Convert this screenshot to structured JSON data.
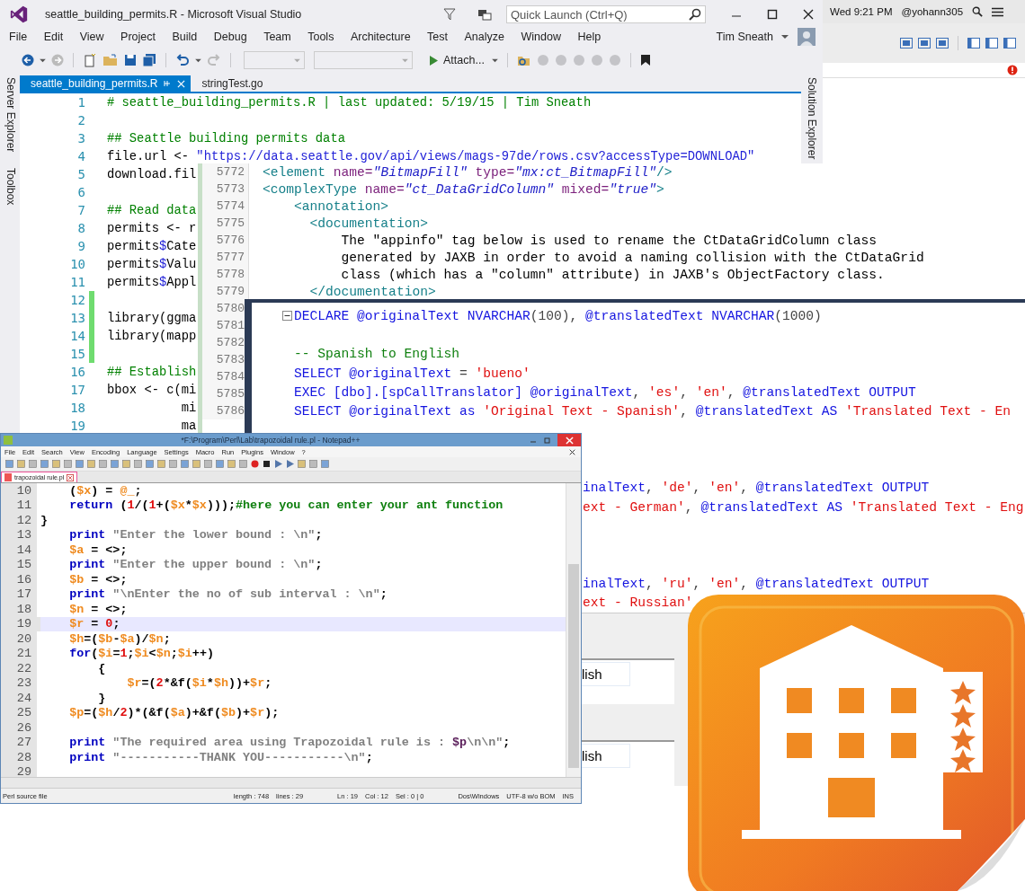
{
  "vs": {
    "title": "seattle_building_permits.R - Microsoft Visual Studio",
    "quick_launch": {
      "placeholder": "Quick Launch (Ctrl+Q)"
    },
    "menu": [
      "File",
      "Edit",
      "View",
      "Project",
      "Build",
      "Debug",
      "Team",
      "Tools",
      "Architecture",
      "Test",
      "Analyze",
      "Window",
      "Help"
    ],
    "user": "Tim Sneath",
    "attach_button": "Attach...",
    "side_tabs": [
      "Server Explorer",
      "Toolbox"
    ],
    "right_tab": "Solution Explorer",
    "tabs": [
      {
        "label": "seattle_building_permits.R",
        "selected": true
      },
      {
        "label": "stringTest.go",
        "selected": false
      }
    ],
    "lines": [
      {
        "n": "1",
        "changed": false,
        "tokens": [
          {
            "kind": "cmt",
            "text": "# seattle_building_permits.R | last updated: 5/19/15 | Tim Sneath"
          }
        ]
      },
      {
        "n": "2",
        "changed": false
      },
      {
        "n": "3",
        "changed": false,
        "tokens": [
          {
            "kind": "cmt",
            "text": "## Seattle building permits data"
          }
        ]
      },
      {
        "n": "4",
        "changed": false,
        "tokens": [
          {
            "kind": "plain",
            "text": "file.url <- "
          },
          {
            "kind": "str",
            "text": "\"https://data.seattle.gov/api/views/mags-97de/rows.csv?accessType=DOWNLOAD\""
          }
        ]
      },
      {
        "n": "5",
        "changed": false,
        "tokens": [
          {
            "kind": "plain",
            "text": "download.fil"
          }
        ]
      },
      {
        "n": "6",
        "changed": false
      },
      {
        "n": "7",
        "changed": false,
        "tokens": [
          {
            "kind": "cmt",
            "text": "## Read data"
          }
        ]
      },
      {
        "n": "8",
        "changed": false,
        "tokens": [
          {
            "kind": "plain",
            "text": "permits <- r"
          }
        ]
      },
      {
        "n": "9",
        "changed": false,
        "tokens": [
          {
            "kind": "plain",
            "text": "permits"
          },
          {
            "kind": "op",
            "text": "$"
          },
          {
            "kind": "plain",
            "text": "Cate"
          }
        ]
      },
      {
        "n": "10",
        "changed": false,
        "tokens": [
          {
            "kind": "plain",
            "text": "permits"
          },
          {
            "kind": "op",
            "text": "$"
          },
          {
            "kind": "plain",
            "text": "Valu"
          }
        ]
      },
      {
        "n": "11",
        "changed": false,
        "tokens": [
          {
            "kind": "plain",
            "text": "permits"
          },
          {
            "kind": "op",
            "text": "$"
          },
          {
            "kind": "plain",
            "text": "Appl"
          }
        ]
      },
      {
        "n": "12",
        "changed": true
      },
      {
        "n": "13",
        "changed": true,
        "tokens": [
          {
            "kind": "plain",
            "text": "library(ggma"
          }
        ]
      },
      {
        "n": "14",
        "changed": true,
        "tokens": [
          {
            "kind": "plain",
            "text": "library(mapp"
          }
        ]
      },
      {
        "n": "15",
        "changed": true
      },
      {
        "n": "16",
        "changed": false,
        "tokens": [
          {
            "kind": "cmt",
            "text": "## Establish"
          }
        ]
      },
      {
        "n": "17",
        "changed": false,
        "tokens": [
          {
            "kind": "plain",
            "text": "bbox <- c(mi"
          }
        ]
      },
      {
        "n": "18",
        "changed": false,
        "tokens": [
          {
            "kind": "plain",
            "text": "          mi"
          }
        ]
      },
      {
        "n": "19",
        "changed": false,
        "tokens": [
          {
            "kind": "plain",
            "text": "          ma"
          }
        ]
      }
    ]
  },
  "mac_bar": {
    "time": "Wed 9:21 PM",
    "user": "@yohann305"
  },
  "xml": {
    "lines": [
      {
        "n": "5772",
        "tokens": [
          {
            "kind": "tag",
            "text": "<element "
          },
          {
            "kind": "attr",
            "text": "name="
          },
          {
            "kind": "val",
            "text": "\"BitmapFill\""
          },
          {
            "kind": "attr",
            "text": " type="
          },
          {
            "kind": "val",
            "text": "\"mx:ct_BitmapFill\""
          },
          {
            "kind": "tag",
            "text": "/>"
          }
        ]
      },
      {
        "n": "5773",
        "tokens": [
          {
            "kind": "tag",
            "text": "<complexType "
          },
          {
            "kind": "attr",
            "text": "name="
          },
          {
            "kind": "val",
            "text": "\"ct_DataGridColumn\""
          },
          {
            "kind": "attr",
            "text": " mixed="
          },
          {
            "kind": "val",
            "text": "\"true\""
          },
          {
            "kind": "tag",
            "text": ">"
          }
        ]
      },
      {
        "n": "5774",
        "tokens": [
          {
            "kind": "tag",
            "text": "    <annotation>"
          }
        ]
      },
      {
        "n": "5775",
        "tokens": [
          {
            "kind": "tag",
            "text": "      <documentation>"
          }
        ]
      },
      {
        "n": "5776",
        "tokens": [
          {
            "kind": "plain",
            "text": "          The \"appinfo\" tag below is used to rename the CtDataGridColumn class"
          }
        ]
      },
      {
        "n": "5777",
        "tokens": [
          {
            "kind": "plain",
            "text": "          generated by JAXB in order to avoid a naming collision with the CtDataGrid"
          }
        ]
      },
      {
        "n": "5778",
        "tokens": [
          {
            "kind": "plain",
            "text": "          class (which has a \"column\" attribute) in JAXB's ObjectFactory class."
          }
        ]
      },
      {
        "n": "5779",
        "tokens": [
          {
            "kind": "tag",
            "text": "      </documentation>"
          }
        ]
      },
      {
        "n": "5780"
      },
      {
        "n": "5781"
      },
      {
        "n": "5782"
      },
      {
        "n": "5783"
      },
      {
        "n": "5784"
      },
      {
        "n": "5785"
      },
      {
        "n": "5786"
      }
    ]
  },
  "sql": {
    "lines": [
      {
        "kind": "full",
        "tokens": [
          {
            "kind": "kw",
            "text": "DECLARE @originalText NVARCHAR"
          },
          {
            "kind": "op",
            "text": "(100), "
          },
          {
            "kind": "kw",
            "text": "@translatedText NVARCHAR"
          },
          {
            "kind": "op",
            "text": "(1000)"
          }
        ]
      },
      {
        "kind": "full"
      },
      {
        "kind": "full",
        "tokens": [
          {
            "kind": "cmt",
            "text": "-- Spanish to English"
          }
        ]
      },
      {
        "kind": "full",
        "tokens": [
          {
            "kind": "kw",
            "text": "SELECT @originalText "
          },
          {
            "kind": "op",
            "text": "= "
          },
          {
            "kind": "str",
            "text": "'bueno'"
          }
        ]
      },
      {
        "kind": "full",
        "tokens": [
          {
            "kind": "kw",
            "text": "EXEC [dbo].[spCallTranslator] @originalText"
          },
          {
            "kind": "op",
            "text": ", "
          },
          {
            "kind": "str",
            "text": "'es'"
          },
          {
            "kind": "op",
            "text": ", "
          },
          {
            "kind": "str",
            "text": "'en'"
          },
          {
            "kind": "op",
            "text": ", "
          },
          {
            "kind": "kw",
            "text": "@translatedText OUTPUT"
          }
        ]
      },
      {
        "kind": "full",
        "tokens": [
          {
            "kind": "kw",
            "text": "SELECT @originalText as "
          },
          {
            "kind": "str",
            "text": "'Original Text - Spanish'"
          },
          {
            "kind": "op",
            "text": ", "
          },
          {
            "kind": "kw",
            "text": "@translatedText AS "
          },
          {
            "kind": "str",
            "text": "'Translated Text - En"
          }
        ]
      },
      {
        "kind": "full"
      },
      {
        "kind": "full"
      },
      {
        "kind": "full"
      },
      {
        "kind": "partial",
        "tokens": [
          {
            "kind": "kw",
            "text": "inalText"
          },
          {
            "kind": "op",
            "text": ", "
          },
          {
            "kind": "str",
            "text": "'de'"
          },
          {
            "kind": "op",
            "text": ", "
          },
          {
            "kind": "str",
            "text": "'en'"
          },
          {
            "kind": "op",
            "text": ", "
          },
          {
            "kind": "kw",
            "text": "@translatedText OUTPUT"
          }
        ]
      },
      {
        "kind": "partial",
        "tokens": [
          {
            "kind": "str",
            "text": "ext - German'"
          },
          {
            "kind": "op",
            "text": ", "
          },
          {
            "kind": "kw",
            "text": "@translatedText AS "
          },
          {
            "kind": "str",
            "text": "'Translated Text - Eng"
          }
        ]
      },
      {
        "kind": "full"
      },
      {
        "kind": "full"
      },
      {
        "kind": "full"
      },
      {
        "kind": "partial",
        "tokens": [
          {
            "kind": "kw",
            "text": "inalText"
          },
          {
            "kind": "op",
            "text": ", "
          },
          {
            "kind": "str",
            "text": "'ru'"
          },
          {
            "kind": "op",
            "text": ", "
          },
          {
            "kind": "str",
            "text": "'en'"
          },
          {
            "kind": "op",
            "text": ", "
          },
          {
            "kind": "kw",
            "text": "@translatedText OUTPUT"
          }
        ]
      },
      {
        "kind": "partial",
        "tokens": [
          {
            "kind": "str",
            "text": "ext - Russian'"
          }
        ]
      }
    ],
    "result_cells": [
      "lish",
      "lish"
    ]
  },
  "npp": {
    "title": "*F:\\Program\\Perl\\Lab\\trapozoidal rule.pl - Notepad++",
    "menu": [
      "File",
      "Edit",
      "Search",
      "View",
      "Encoding",
      "Language",
      "Settings",
      "Macro",
      "Run",
      "Plugins",
      "Window",
      "?"
    ],
    "tab": "trapozoidal rule.pl",
    "lines": [
      {
        "n": "10",
        "selected": false,
        "tokens": [
          {
            "kind": "op",
            "text": "    ("
          },
          {
            "kind": "var",
            "text": "$x"
          },
          {
            "kind": "op",
            "text": ") = "
          },
          {
            "kind": "var",
            "text": "@_"
          },
          {
            "kind": "op",
            "text": ";"
          }
        ]
      },
      {
        "n": "11",
        "selected": false,
        "tokens": [
          {
            "kind": "kw",
            "text": "    return"
          },
          {
            "kind": "op",
            "text": " ("
          },
          {
            "kind": "num",
            "text": "1"
          },
          {
            "kind": "op",
            "text": "/("
          },
          {
            "kind": "num",
            "text": "1"
          },
          {
            "kind": "op",
            "text": "+("
          },
          {
            "kind": "var",
            "text": "$x"
          },
          {
            "kind": "op",
            "text": "*"
          },
          {
            "kind": "var",
            "text": "$x"
          },
          {
            "kind": "op",
            "text": ")));"
          },
          {
            "kind": "cmt",
            "text": "#here you can enter your ant function"
          }
        ]
      },
      {
        "n": "12",
        "selected": false,
        "tokens": [
          {
            "kind": "op",
            "text": "}"
          }
        ]
      },
      {
        "n": "13",
        "selected": false,
        "tokens": [
          {
            "kind": "kw",
            "text": "    print"
          },
          {
            "kind": "str",
            "text": " \"Enter the lower bound : \\n\""
          },
          {
            "kind": "op",
            "text": ";"
          }
        ]
      },
      {
        "n": "14",
        "selected": false,
        "tokens": [
          {
            "kind": "var",
            "text": "    $a"
          },
          {
            "kind": "op",
            "text": " = <>;"
          }
        ]
      },
      {
        "n": "15",
        "selected": false,
        "tokens": [
          {
            "kind": "kw",
            "text": "    print"
          },
          {
            "kind": "str",
            "text": " \"Enter the upper bound : \\n\""
          },
          {
            "kind": "op",
            "text": ";"
          }
        ]
      },
      {
        "n": "16",
        "selected": false,
        "tokens": [
          {
            "kind": "var",
            "text": "    $b"
          },
          {
            "kind": "op",
            "text": " = <>;"
          }
        ]
      },
      {
        "n": "17",
        "selected": false,
        "tokens": [
          {
            "kind": "kw",
            "text": "    print"
          },
          {
            "kind": "str",
            "text": " \"\\nEnter the no of sub interval : \\n\""
          },
          {
            "kind": "op",
            "text": ";"
          }
        ]
      },
      {
        "n": "18",
        "selected": false,
        "tokens": [
          {
            "kind": "var",
            "text": "    $n"
          },
          {
            "kind": "op",
            "text": " = <>;"
          }
        ]
      },
      {
        "n": "19",
        "selected": true,
        "tokens": [
          {
            "kind": "var",
            "text": "    $r"
          },
          {
            "kind": "op",
            "text": " = "
          },
          {
            "kind": "num",
            "text": "0"
          },
          {
            "kind": "op",
            "text": ";"
          }
        ]
      },
      {
        "n": "20",
        "selected": false,
        "tokens": [
          {
            "kind": "var",
            "text": "    $h"
          },
          {
            "kind": "op",
            "text": "=("
          },
          {
            "kind": "var",
            "text": "$b"
          },
          {
            "kind": "op",
            "text": "-"
          },
          {
            "kind": "var",
            "text": "$a"
          },
          {
            "kind": "op",
            "text": ")/"
          },
          {
            "kind": "var",
            "text": "$n"
          },
          {
            "kind": "op",
            "text": ";"
          }
        ]
      },
      {
        "n": "21",
        "selected": false,
        "tokens": [
          {
            "kind": "kw",
            "text": "    for"
          },
          {
            "kind": "op",
            "text": "("
          },
          {
            "kind": "var",
            "text": "$i"
          },
          {
            "kind": "op",
            "text": "="
          },
          {
            "kind": "num",
            "text": "1"
          },
          {
            "kind": "op",
            "text": ";"
          },
          {
            "kind": "var",
            "text": "$i"
          },
          {
            "kind": "op",
            "text": "<"
          },
          {
            "kind": "var",
            "text": "$n"
          },
          {
            "kind": "op",
            "text": ";"
          },
          {
            "kind": "var",
            "text": "$i"
          },
          {
            "kind": "op",
            "text": "++)"
          }
        ]
      },
      {
        "n": "22",
        "selected": false,
        "tokens": [
          {
            "kind": "op",
            "text": "        {"
          }
        ]
      },
      {
        "n": "23",
        "selected": false,
        "tokens": [
          {
            "kind": "var",
            "text": "            $r"
          },
          {
            "kind": "op",
            "text": "=("
          },
          {
            "kind": "num",
            "text": "2"
          },
          {
            "kind": "op",
            "text": "*&f("
          },
          {
            "kind": "var",
            "text": "$i"
          },
          {
            "kind": "op",
            "text": "*"
          },
          {
            "kind": "var",
            "text": "$h"
          },
          {
            "kind": "op",
            "text": "))+"
          },
          {
            "kind": "var",
            "text": "$r"
          },
          {
            "kind": "op",
            "text": ";"
          }
        ]
      },
      {
        "n": "24",
        "selected": false,
        "tokens": [
          {
            "kind": "op",
            "text": "        }"
          }
        ]
      },
      {
        "n": "25",
        "selected": false,
        "tokens": [
          {
            "kind": "var",
            "text": "    $p"
          },
          {
            "kind": "op",
            "text": "=("
          },
          {
            "kind": "var",
            "text": "$h"
          },
          {
            "kind": "op",
            "text": "/"
          },
          {
            "kind": "num",
            "text": "2"
          },
          {
            "kind": "op",
            "text": ")*(&f("
          },
          {
            "kind": "var",
            "text": "$a"
          },
          {
            "kind": "op",
            "text": ")+&f("
          },
          {
            "kind": "var",
            "text": "$b"
          },
          {
            "kind": "op",
            "text": ")+"
          },
          {
            "kind": "var",
            "text": "$r"
          },
          {
            "kind": "op",
            "text": ");"
          }
        ]
      },
      {
        "n": "26",
        "selected": false
      },
      {
        "n": "27",
        "selected": false,
        "tokens": [
          {
            "kind": "kw",
            "text": "    print"
          },
          {
            "kind": "str",
            "text": " \"The required area using Trapozoidal rule is : "
          },
          {
            "kind": "pvar",
            "text": "$p"
          },
          {
            "kind": "str",
            "text": "\\n\\n\""
          },
          {
            "kind": "op",
            "text": ";"
          }
        ]
      },
      {
        "n": "28",
        "selected": false,
        "tokens": [
          {
            "kind": "kw",
            "text": "    print"
          },
          {
            "kind": "str",
            "text": " \"-----------THANK YOU-----------\\n\""
          },
          {
            "kind": "op",
            "text": ";"
          }
        ]
      },
      {
        "n": "29",
        "selected": false
      }
    ],
    "status": {
      "type": "Perl source file",
      "length": "length : 748",
      "lines": "lines : 29",
      "ln": "Ln : 19",
      "col": "Col : 12",
      "sel": "Sel : 0 | 0",
      "eol": "Dos\\Windows",
      "encoding": "UTF-8 w/o BOM",
      "mode": "INS"
    }
  }
}
